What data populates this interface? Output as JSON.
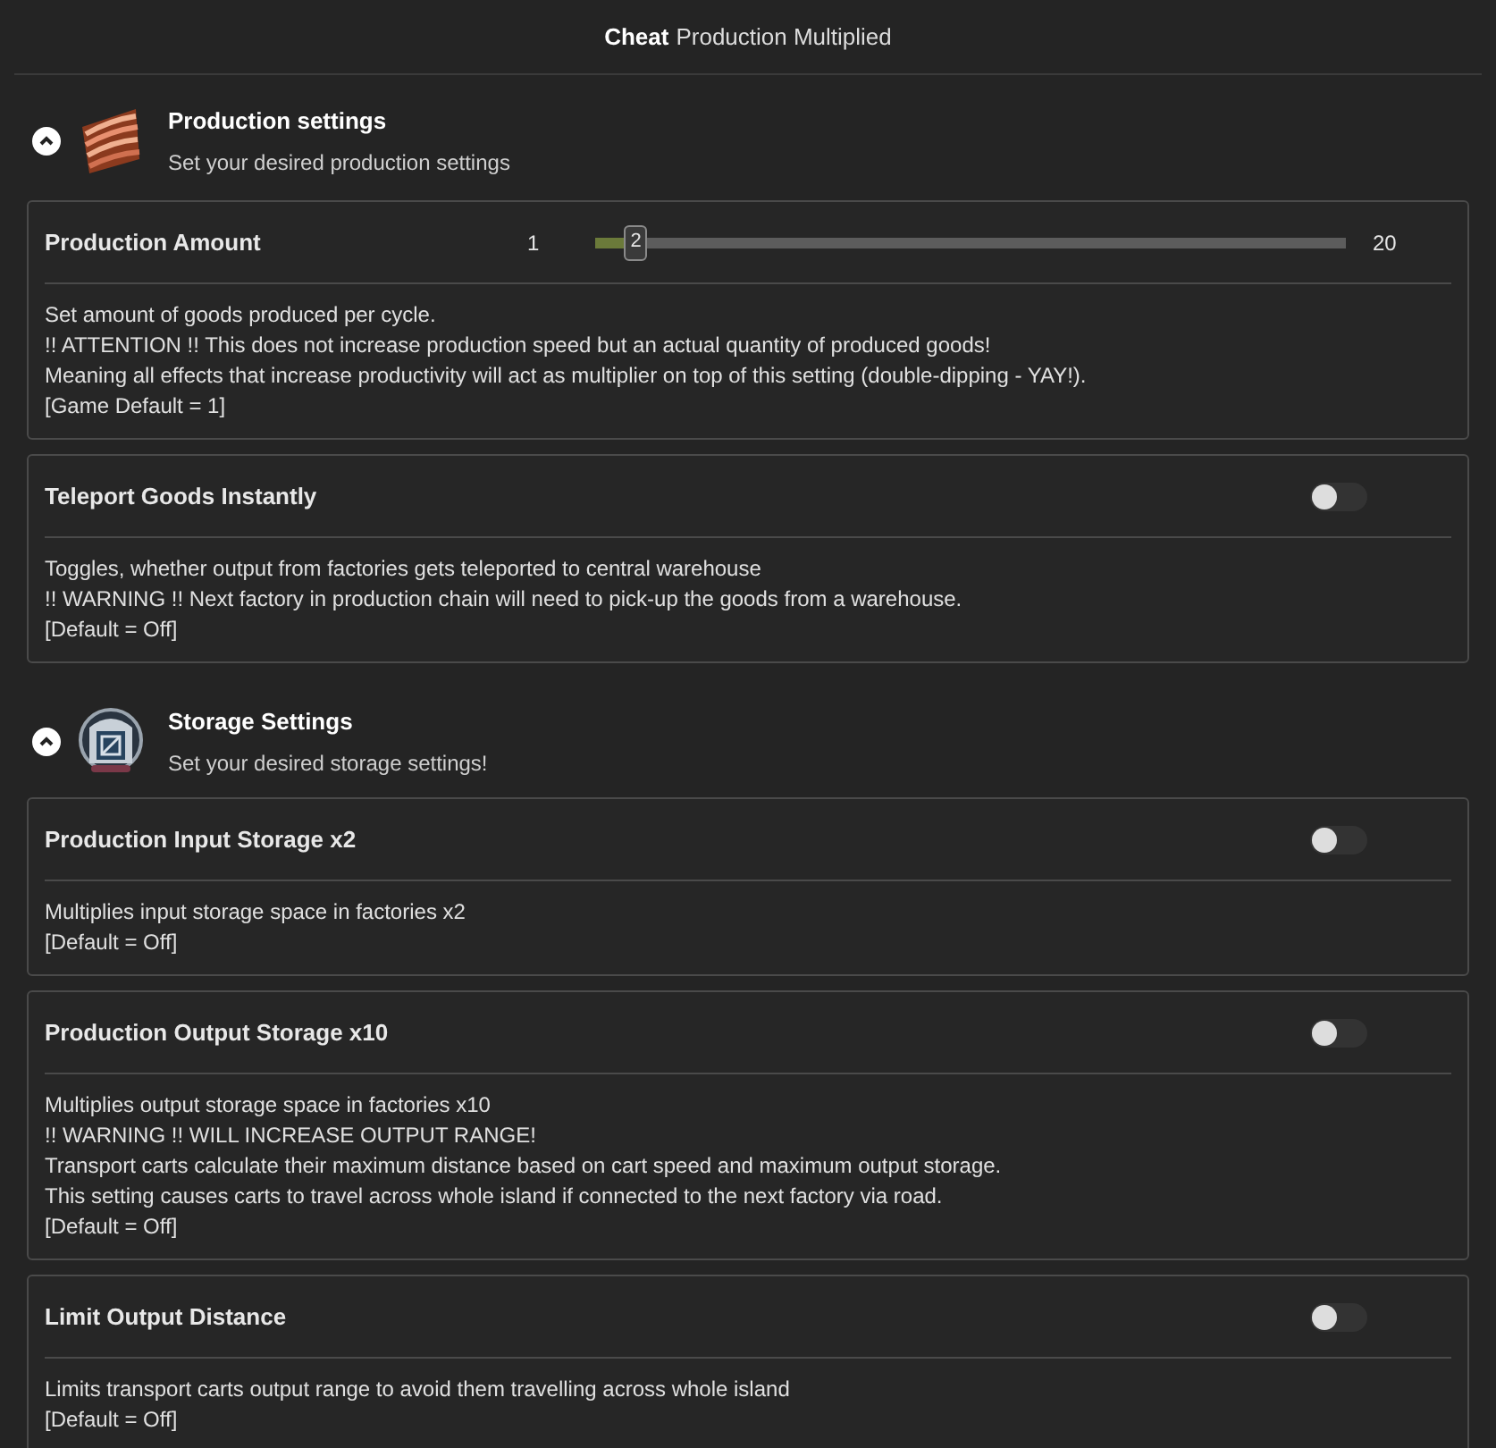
{
  "title": {
    "bold": "Cheat",
    "rest": "Production Multiplied"
  },
  "sections": [
    {
      "kind": "production",
      "title": "Production settings",
      "subtitle": "Set your desired production settings",
      "expanded": true,
      "settings": [
        {
          "kind": "slider",
          "label": "Production Amount",
          "min": "1",
          "max": "20",
          "value": "2",
          "level": 0.053,
          "description": [
            "Set amount of goods produced per cycle.",
            "!! ATTENTION !! This does not increase production speed but an actual quantity of produced goods!",
            "Meaning all effects that increase productivity will act as multiplier on top of this setting (double-dipping - YAY!).",
            "[Game Default = 1]"
          ]
        },
        {
          "kind": "toggle",
          "label": "Teleport Goods Instantly",
          "on": false,
          "description": [
            "Toggles, whether output from factories gets teleported to central warehouse",
            "!! WARNING !! Next factory in production chain will need to pick-up the goods from a warehouse.",
            "[Default = Off]"
          ]
        }
      ]
    },
    {
      "kind": "storage",
      "title": "Storage Settings",
      "subtitle": "Set your desired storage settings!",
      "expanded": true,
      "settings": [
        {
          "kind": "toggle",
          "label": "Production Input Storage x2",
          "on": false,
          "description": [
            "Multiplies input storage space in factories x2",
            "[Default = Off]"
          ]
        },
        {
          "kind": "toggle",
          "label": "Production Output Storage x10",
          "on": false,
          "description": [
            "Multiplies output storage space in factories x10",
            "!! WARNING !! WILL INCREASE OUTPUT RANGE!",
            "Transport carts calculate their maximum distance based on cart speed and maximum output storage.",
            "This setting causes carts to travel across whole island if connected to the next factory via road.",
            "[Default = Off]"
          ]
        },
        {
          "kind": "toggle",
          "label": "Limit Output Distance",
          "on": false,
          "description": [
            "Limits transport carts output range to avoid them travelling across whole island",
            "[Default = Off]"
          ]
        }
      ]
    }
  ]
}
